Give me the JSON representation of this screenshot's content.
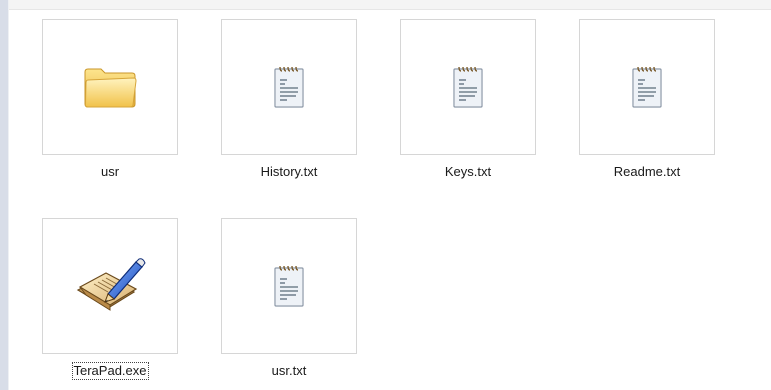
{
  "files": [
    {
      "name": "usr",
      "icon": "folder-icon"
    },
    {
      "name": "History.txt",
      "icon": "text-file-icon"
    },
    {
      "name": "Keys.txt",
      "icon": "text-file-icon"
    },
    {
      "name": "Readme.txt",
      "icon": "text-file-icon"
    },
    {
      "name": "TeraPad.exe",
      "icon": "terapad-app-icon",
      "selected": true
    },
    {
      "name": "usr.txt",
      "icon": "text-file-icon"
    }
  ],
  "colors": {
    "folder": "#f6d56c",
    "pencil": "#2a63d8",
    "paper": "#ffffff",
    "lines": "#5a6b7a"
  }
}
